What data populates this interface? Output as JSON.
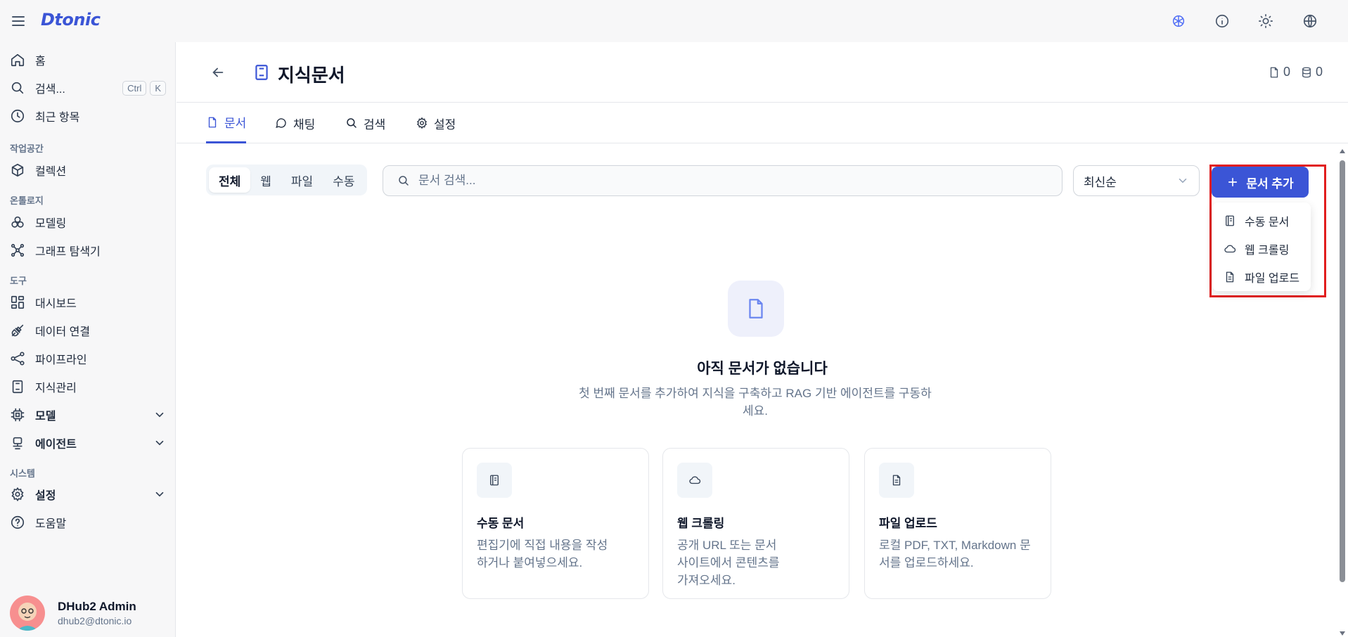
{
  "app": {
    "logo": "Dtonic"
  },
  "sidebar": {
    "home": "홈",
    "search": "검색...",
    "search_kbd": [
      "Ctrl",
      "K"
    ],
    "recent": "최근 항목",
    "sections": {
      "workspace": "작업공간",
      "ontology": "온톨로지",
      "tools": "도구",
      "system": "시스템"
    },
    "items": {
      "collection": "컬렉션",
      "modeling": "모델링",
      "graph": "그래프 탐색기",
      "dashboard": "대시보드",
      "data": "데이터 연결",
      "pipeline": "파이프라인",
      "knowledge": "지식관리",
      "model": "모델",
      "agent": "에이전트",
      "settings": "설정",
      "help": "도움말"
    },
    "user": {
      "name": "DHub2 Admin",
      "email": "dhub2@dtonic.io"
    }
  },
  "header": {
    "title": "지식문서",
    "doc_count": "0",
    "db_count": "0"
  },
  "tabs": [
    "문서",
    "채팅",
    "검색",
    "설정"
  ],
  "filters": {
    "segments": [
      "전체",
      "웹",
      "파일",
      "수동"
    ],
    "search_placeholder": "문서 검색...",
    "sort": "최신순"
  },
  "add_button": "문서 추가",
  "add_menu": [
    "수동 문서",
    "웹 크롤링",
    "파일 업로드"
  ],
  "empty": {
    "title": "아직 문서가 없습니다",
    "subtitle": "첫 번째 문서를 추가하여 지식을 구축하고 RAG 기반 에이전트를 구동하세요."
  },
  "cards": [
    {
      "title": "수동 문서",
      "desc": "편집기에 직접 내용을 작성하거나 붙여넣으세요."
    },
    {
      "title": "웹 크롤링",
      "desc": "공개 URL 또는 문서 사이트에서 콘텐츠를 가져오세요."
    },
    {
      "title": "파일 업로드",
      "desc": "로컬 PDF, TXT, Markdown 문서를 업로드하세요."
    }
  ],
  "colors": {
    "accent": "#3b55d6",
    "highlight": "#e11d1d"
  }
}
